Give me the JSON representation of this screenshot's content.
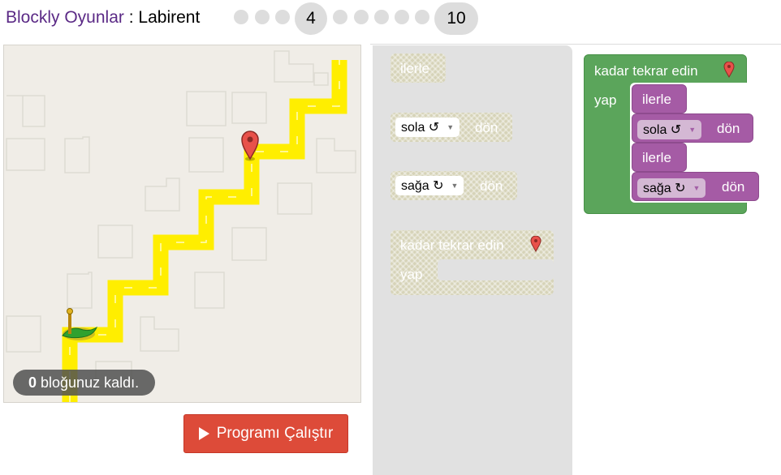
{
  "header": {
    "app_name": "Blockly Oyunlar",
    "separator": " : ",
    "game_name": "Labirent",
    "levels": [
      "4",
      "10"
    ]
  },
  "maze": {
    "capacity_count": "0",
    "capacity_text": " bloğunuz kaldı."
  },
  "run_button": {
    "label": "Programı Çalıştır"
  },
  "toolbox": {
    "move_forward": "ilerle",
    "turn_left": {
      "dropdown": "sola ↺",
      "suffix": "dön"
    },
    "turn_right": {
      "dropdown": "sağa ↻",
      "suffix": "dön"
    },
    "repeat": {
      "label": "kadar tekrar edin",
      "do": "yap"
    }
  },
  "workspace": {
    "repeat": {
      "label": "kadar tekrar edin",
      "do": "yap"
    },
    "statements": [
      {
        "label": "ilerle"
      },
      {
        "dropdown": "sola ↺",
        "suffix": "dön"
      },
      {
        "label": "ilerle"
      },
      {
        "dropdown": "sağa ↻",
        "suffix": "dön"
      }
    ]
  },
  "colors": {
    "title": "#5b2a86",
    "run_button": "#dd4b39",
    "loop_block": "#5ba55b",
    "motion_block": "#a55ba5",
    "path": "#ffee00"
  }
}
